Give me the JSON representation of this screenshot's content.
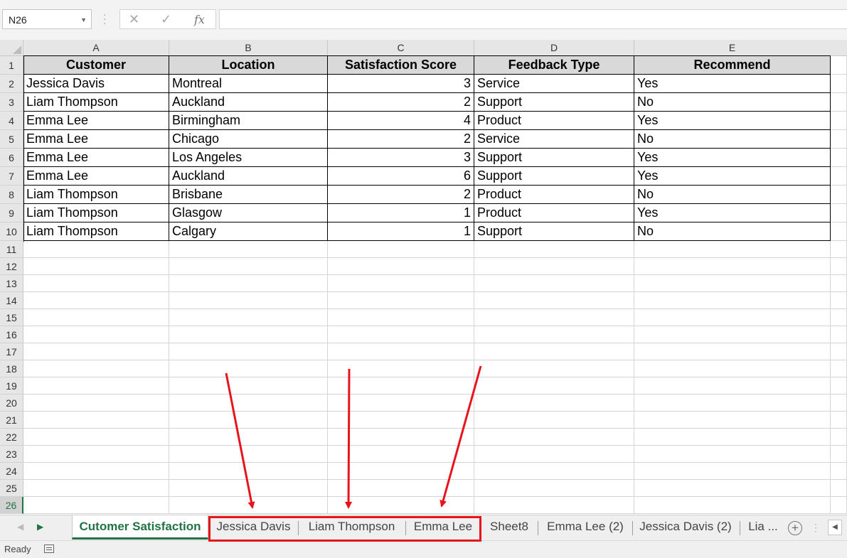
{
  "formula_bar": {
    "name_box": "N26",
    "cancel_icon": "x-icon",
    "enter_icon": "check-icon",
    "function_label": "fx",
    "formula_value": ""
  },
  "columns": [
    "A",
    "B",
    "C",
    "D",
    "E"
  ],
  "rows": [
    "1",
    "2",
    "3",
    "4",
    "5",
    "6",
    "7",
    "8",
    "9",
    "10",
    "11",
    "12",
    "13",
    "14",
    "15",
    "16",
    "17",
    "18",
    "19",
    "20",
    "21",
    "22",
    "23",
    "24",
    "25",
    "26"
  ],
  "active_row": "26",
  "table": {
    "headers": [
      "Customer",
      "Location",
      "Satisfaction Score",
      "Feedback Type",
      "Recommend"
    ],
    "data": [
      [
        "Jessica Davis",
        "Montreal",
        "3",
        "Service",
        "Yes"
      ],
      [
        "Liam Thompson",
        "Auckland",
        "2",
        "Support",
        "No"
      ],
      [
        "Emma Lee",
        "Birmingham",
        "4",
        "Product",
        "Yes"
      ],
      [
        "Emma Lee",
        "Chicago",
        "2",
        "Service",
        "No"
      ],
      [
        "Emma Lee",
        "Los Angeles",
        "3",
        "Support",
        "Yes"
      ],
      [
        "Emma Lee",
        "Auckland",
        "6",
        "Support",
        "Yes"
      ],
      [
        "Liam Thompson",
        "Brisbane",
        "2",
        "Product",
        "No"
      ],
      [
        "Liam Thompson",
        "Glasgow",
        "1",
        "Product",
        "Yes"
      ],
      [
        "Liam Thompson",
        "Calgary",
        "1",
        "Support",
        "No"
      ]
    ]
  },
  "sheet_tabs": {
    "active": "Cutomer Satisfaction",
    "others": [
      "Jessica Davis",
      "Liam Thompson",
      "Emma Lee",
      "Sheet8",
      "Emma Lee (2)",
      "Jessica Davis (2)",
      "Lia ..."
    ]
  },
  "status": {
    "text": "Ready"
  },
  "colors": {
    "accent": "#217346",
    "annotation": "#e8141c",
    "header_fill": "#d9d9d9"
  }
}
